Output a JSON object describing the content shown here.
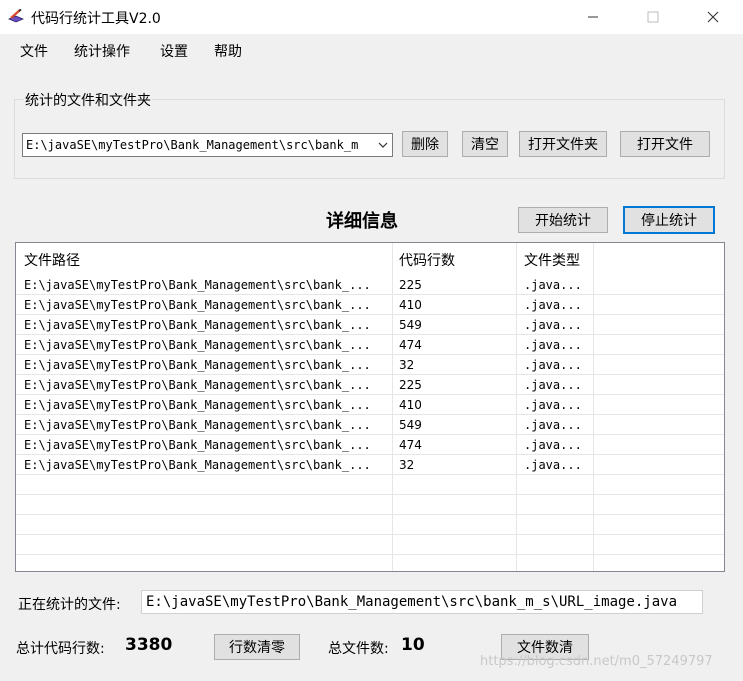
{
  "window": {
    "title": "代码行统计工具V2.0",
    "icons": {
      "app": "pencil-cube-icon",
      "minimize": "minimize-icon",
      "maximize": "maximize-icon",
      "close": "close-icon"
    }
  },
  "menu": {
    "items": [
      "文件",
      "统计操作",
      "设置",
      "帮助"
    ]
  },
  "selection": {
    "group_label": "统计的文件和文件夹",
    "combo_value": "E:\\javaSE\\myTestPro\\Bank_Management\\src\\bank_m",
    "buttons": {
      "delete": "删除",
      "clear": "清空",
      "open_folder": "打开文件夹",
      "open_file": "打开文件"
    }
  },
  "details": {
    "title": "详细信息",
    "start_button": "开始统计",
    "stop_button": "停止统计",
    "columns": [
      "文件路径",
      "代码行数",
      "文件类型"
    ],
    "rows": [
      {
        "path": "E:\\javaSE\\myTestPro\\Bank_Management\\src\\bank_...",
        "lines": "225",
        "type": ".java..."
      },
      {
        "path": "E:\\javaSE\\myTestPro\\Bank_Management\\src\\bank_...",
        "lines": "410",
        "type": ".java..."
      },
      {
        "path": "E:\\javaSE\\myTestPro\\Bank_Management\\src\\bank_...",
        "lines": "549",
        "type": ".java..."
      },
      {
        "path": "E:\\javaSE\\myTestPro\\Bank_Management\\src\\bank_...",
        "lines": "474",
        "type": ".java..."
      },
      {
        "path": "E:\\javaSE\\myTestPro\\Bank_Management\\src\\bank_...",
        "lines": "32",
        "type": ".java..."
      },
      {
        "path": "E:\\javaSE\\myTestPro\\Bank_Management\\src\\bank_...",
        "lines": "225",
        "type": ".java..."
      },
      {
        "path": "E:\\javaSE\\myTestPro\\Bank_Management\\src\\bank_...",
        "lines": "410",
        "type": ".java..."
      },
      {
        "path": "E:\\javaSE\\myTestPro\\Bank_Management\\src\\bank_...",
        "lines": "549",
        "type": ".java..."
      },
      {
        "path": "E:\\javaSE\\myTestPro\\Bank_Management\\src\\bank_...",
        "lines": "474",
        "type": ".java..."
      },
      {
        "path": "E:\\javaSE\\myTestPro\\Bank_Management\\src\\bank_...",
        "lines": "32",
        "type": ".java..."
      }
    ]
  },
  "status": {
    "current_label": "正在统计的文件:",
    "current_file": "E:\\javaSE\\myTestPro\\Bank_Management\\src\\bank_m_s\\URL_image.java",
    "total_lines_label": "总计代码行数:",
    "total_lines": "3380",
    "reset_lines_button": "行数清零",
    "total_files_label": "总文件数:",
    "total_files": "10",
    "reset_files_button": "文件数清"
  },
  "watermark": "https://blog.csdn.net/m0_57249797"
}
